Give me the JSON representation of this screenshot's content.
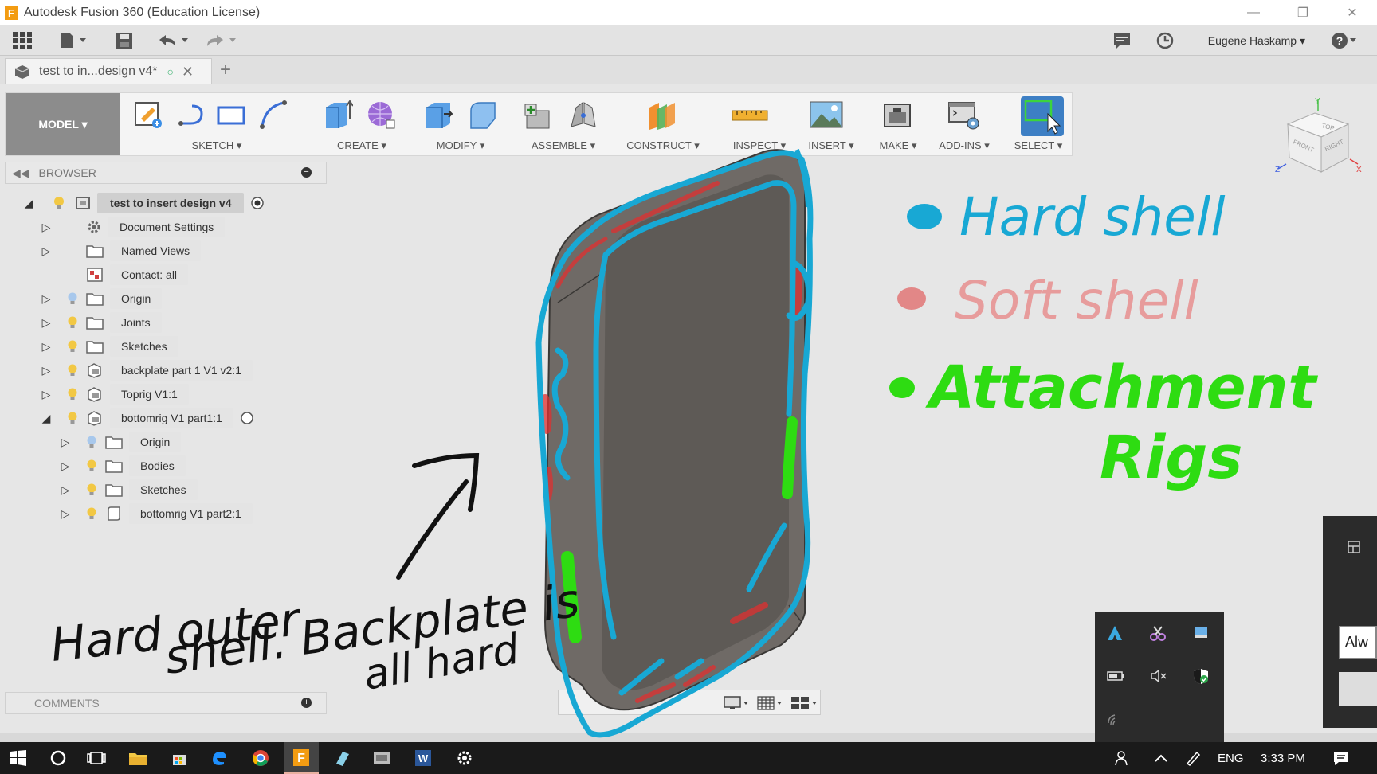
{
  "window": {
    "title": "Autodesk Fusion 360 (Education License)"
  },
  "quick_access": {
    "user": "Eugene Haskamp ▾"
  },
  "tabs": {
    "doc_tab": "test to in...design v4*"
  },
  "ribbon": {
    "model_label": "MODEL ▾",
    "groups": [
      {
        "label": "SKETCH ▾"
      },
      {
        "label": "CREATE ▾"
      },
      {
        "label": "MODIFY ▾"
      },
      {
        "label": "ASSEMBLE ▾"
      },
      {
        "label": "CONSTRUCT ▾"
      },
      {
        "label": "INSPECT ▾"
      },
      {
        "label": "INSERT ▾"
      },
      {
        "label": "MAKE ▾"
      },
      {
        "label": "ADD-INS ▾"
      },
      {
        "label": "SELECT ▾"
      }
    ]
  },
  "browser": {
    "header": "BROWSER",
    "root": "test to insert design v4",
    "items": [
      {
        "label": "Document Settings"
      },
      {
        "label": "Named Views"
      },
      {
        "label": "Contact: all"
      },
      {
        "label": "Origin"
      },
      {
        "label": "Joints"
      },
      {
        "label": "Sketches"
      },
      {
        "label": "backplate part 1 V1 v2:1"
      },
      {
        "label": "Toprig V1:1"
      },
      {
        "label": "bottomrig V1 part1:1"
      },
      {
        "label": "Origin"
      },
      {
        "label": "Bodies"
      },
      {
        "label": "Sketches"
      },
      {
        "label": "bottomrig V1 part2:1"
      }
    ]
  },
  "comments": {
    "header": "COMMENTS"
  },
  "annotations": {
    "hard_shell": "Hard shell",
    "soft_shell": "Soft shell",
    "attachment": "Attachment",
    "rigs": "Rigs",
    "note_line1": "Hard outer",
    "note_line2": "shell. Backplate is",
    "note_line3": "all hard"
  },
  "viewcube": {
    "top": "TOP",
    "front": "FRONT",
    "right": "RIGHT"
  },
  "flyout": {
    "always_label": "Alw"
  },
  "taskbar": {
    "lang": "ENG",
    "time": "3:33 PM"
  }
}
